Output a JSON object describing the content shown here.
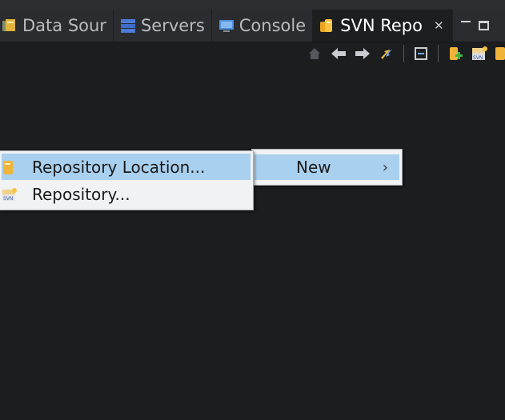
{
  "tabs": [
    {
      "label": "Data Sour",
      "icon": "data-source-explorer-icon"
    },
    {
      "label": "Servers",
      "icon": "servers-icon"
    },
    {
      "label": "Console",
      "icon": "console-icon"
    },
    {
      "label": "SVN Repo",
      "icon": "svn-repository-icon",
      "active": true
    }
  ],
  "view_toolbar": [
    "home-icon",
    "back-arrow-icon",
    "forward-arrow-icon",
    "refresh-icon",
    "collapse-all-icon",
    "add-repository-location-icon",
    "new-svn-repository-icon",
    "checkout-icon"
  ],
  "context_menu": {
    "new_label": "New",
    "submenu_indicator": "›"
  },
  "new_submenu": {
    "items": [
      {
        "label": "Repository Location...",
        "icon": "repository-location-icon",
        "highlighted": true
      },
      {
        "label": "Repository...",
        "icon": "svn-repository-icon",
        "highlighted": false
      }
    ]
  },
  "colors": {
    "background": "#1b1d1f",
    "tabbar": "#2a2c2f",
    "menu_bg": "#f1f2f3",
    "menu_highlight": "#a9d0ef"
  }
}
